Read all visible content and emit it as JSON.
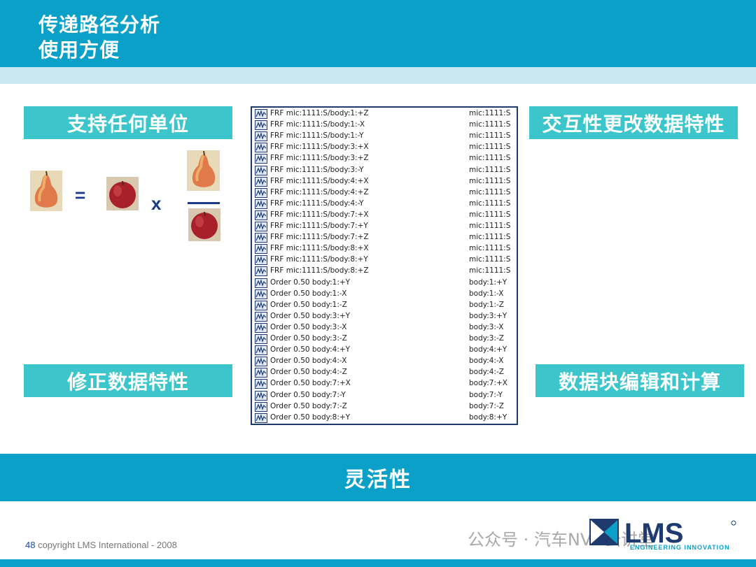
{
  "header": {
    "title_line1": "传递路径分析",
    "title_line2": "使用方便"
  },
  "features": {
    "units": "支持任何单位",
    "interactive": "交互性更改数据特性",
    "modify": "修正数据特性",
    "blocks": "数据块编辑和计算"
  },
  "equation": {
    "equals": "=",
    "times": "x"
  },
  "list": {
    "rows": [
      {
        "name": "FRF mic:1111:S/body:1:+Z",
        "ref": "mic:1111:S"
      },
      {
        "name": "FRF mic:1111:S/body:1:-X",
        "ref": "mic:1111:S"
      },
      {
        "name": "FRF mic:1111:S/body:1:-Y",
        "ref": "mic:1111:S"
      },
      {
        "name": "FRF mic:1111:S/body:3:+X",
        "ref": "mic:1111:S"
      },
      {
        "name": "FRF mic:1111:S/body:3:+Z",
        "ref": "mic:1111:S"
      },
      {
        "name": "FRF mic:1111:S/body:3:-Y",
        "ref": "mic:1111:S"
      },
      {
        "name": "FRF mic:1111:S/body:4:+X",
        "ref": "mic:1111:S"
      },
      {
        "name": "FRF mic:1111:S/body:4:+Z",
        "ref": "mic:1111:S"
      },
      {
        "name": "FRF mic:1111:S/body:4:-Y",
        "ref": "mic:1111:S"
      },
      {
        "name": "FRF mic:1111:S/body:7:+X",
        "ref": "mic:1111:S"
      },
      {
        "name": "FRF mic:1111:S/body:7:+Y",
        "ref": "mic:1111:S"
      },
      {
        "name": "FRF mic:1111:S/body:7:+Z",
        "ref": "mic:1111:S"
      },
      {
        "name": "FRF mic:1111:S/body:8:+X",
        "ref": "mic:1111:S"
      },
      {
        "name": "FRF mic:1111:S/body:8:+Y",
        "ref": "mic:1111:S"
      },
      {
        "name": "FRF mic:1111:S/body:8:+Z",
        "ref": "mic:1111:S"
      },
      {
        "name": "Order 0.50 body:1:+Y",
        "ref": "body:1:+Y"
      },
      {
        "name": "Order 0.50 body:1:-X",
        "ref": "body:1:-X"
      },
      {
        "name": "Order 0.50 body:1:-Z",
        "ref": "body:1:-Z"
      },
      {
        "name": "Order 0.50 body:3:+Y",
        "ref": "body:3:+Y"
      },
      {
        "name": "Order 0.50 body:3:-X",
        "ref": "body:3:-X"
      },
      {
        "name": "Order 0.50 body:3:-Z",
        "ref": "body:3:-Z"
      },
      {
        "name": "Order 0.50 body:4:+Y",
        "ref": "body:4:+Y"
      },
      {
        "name": "Order 0.50 body:4:-X",
        "ref": "body:4:-X"
      },
      {
        "name": "Order 0.50 body:4:-Z",
        "ref": "body:4:-Z"
      },
      {
        "name": "Order 0.50 body:7:+X",
        "ref": "body:7:+X"
      },
      {
        "name": "Order 0.50 body:7:-Y",
        "ref": "body:7:-Y"
      },
      {
        "name": "Order 0.50 body:7:-Z",
        "ref": "body:7:-Z"
      },
      {
        "name": "Order 0.50 body:8:+Y",
        "ref": "body:8:+Y"
      }
    ]
  },
  "bottom_bar": {
    "label": "灵活性"
  },
  "footer": {
    "page_number": "48",
    "copyright": " copyright LMS International - 2008"
  },
  "logo": {
    "text": "LMS",
    "tagline": "ENGINEERING INNOVATION"
  },
  "watermark": {
    "text": "公众号 · 汽车NVH云讲堂"
  },
  "colors": {
    "header": "#0aa0c8",
    "feature_box": "#3cc6cc",
    "navy": "#1a3a8a"
  }
}
